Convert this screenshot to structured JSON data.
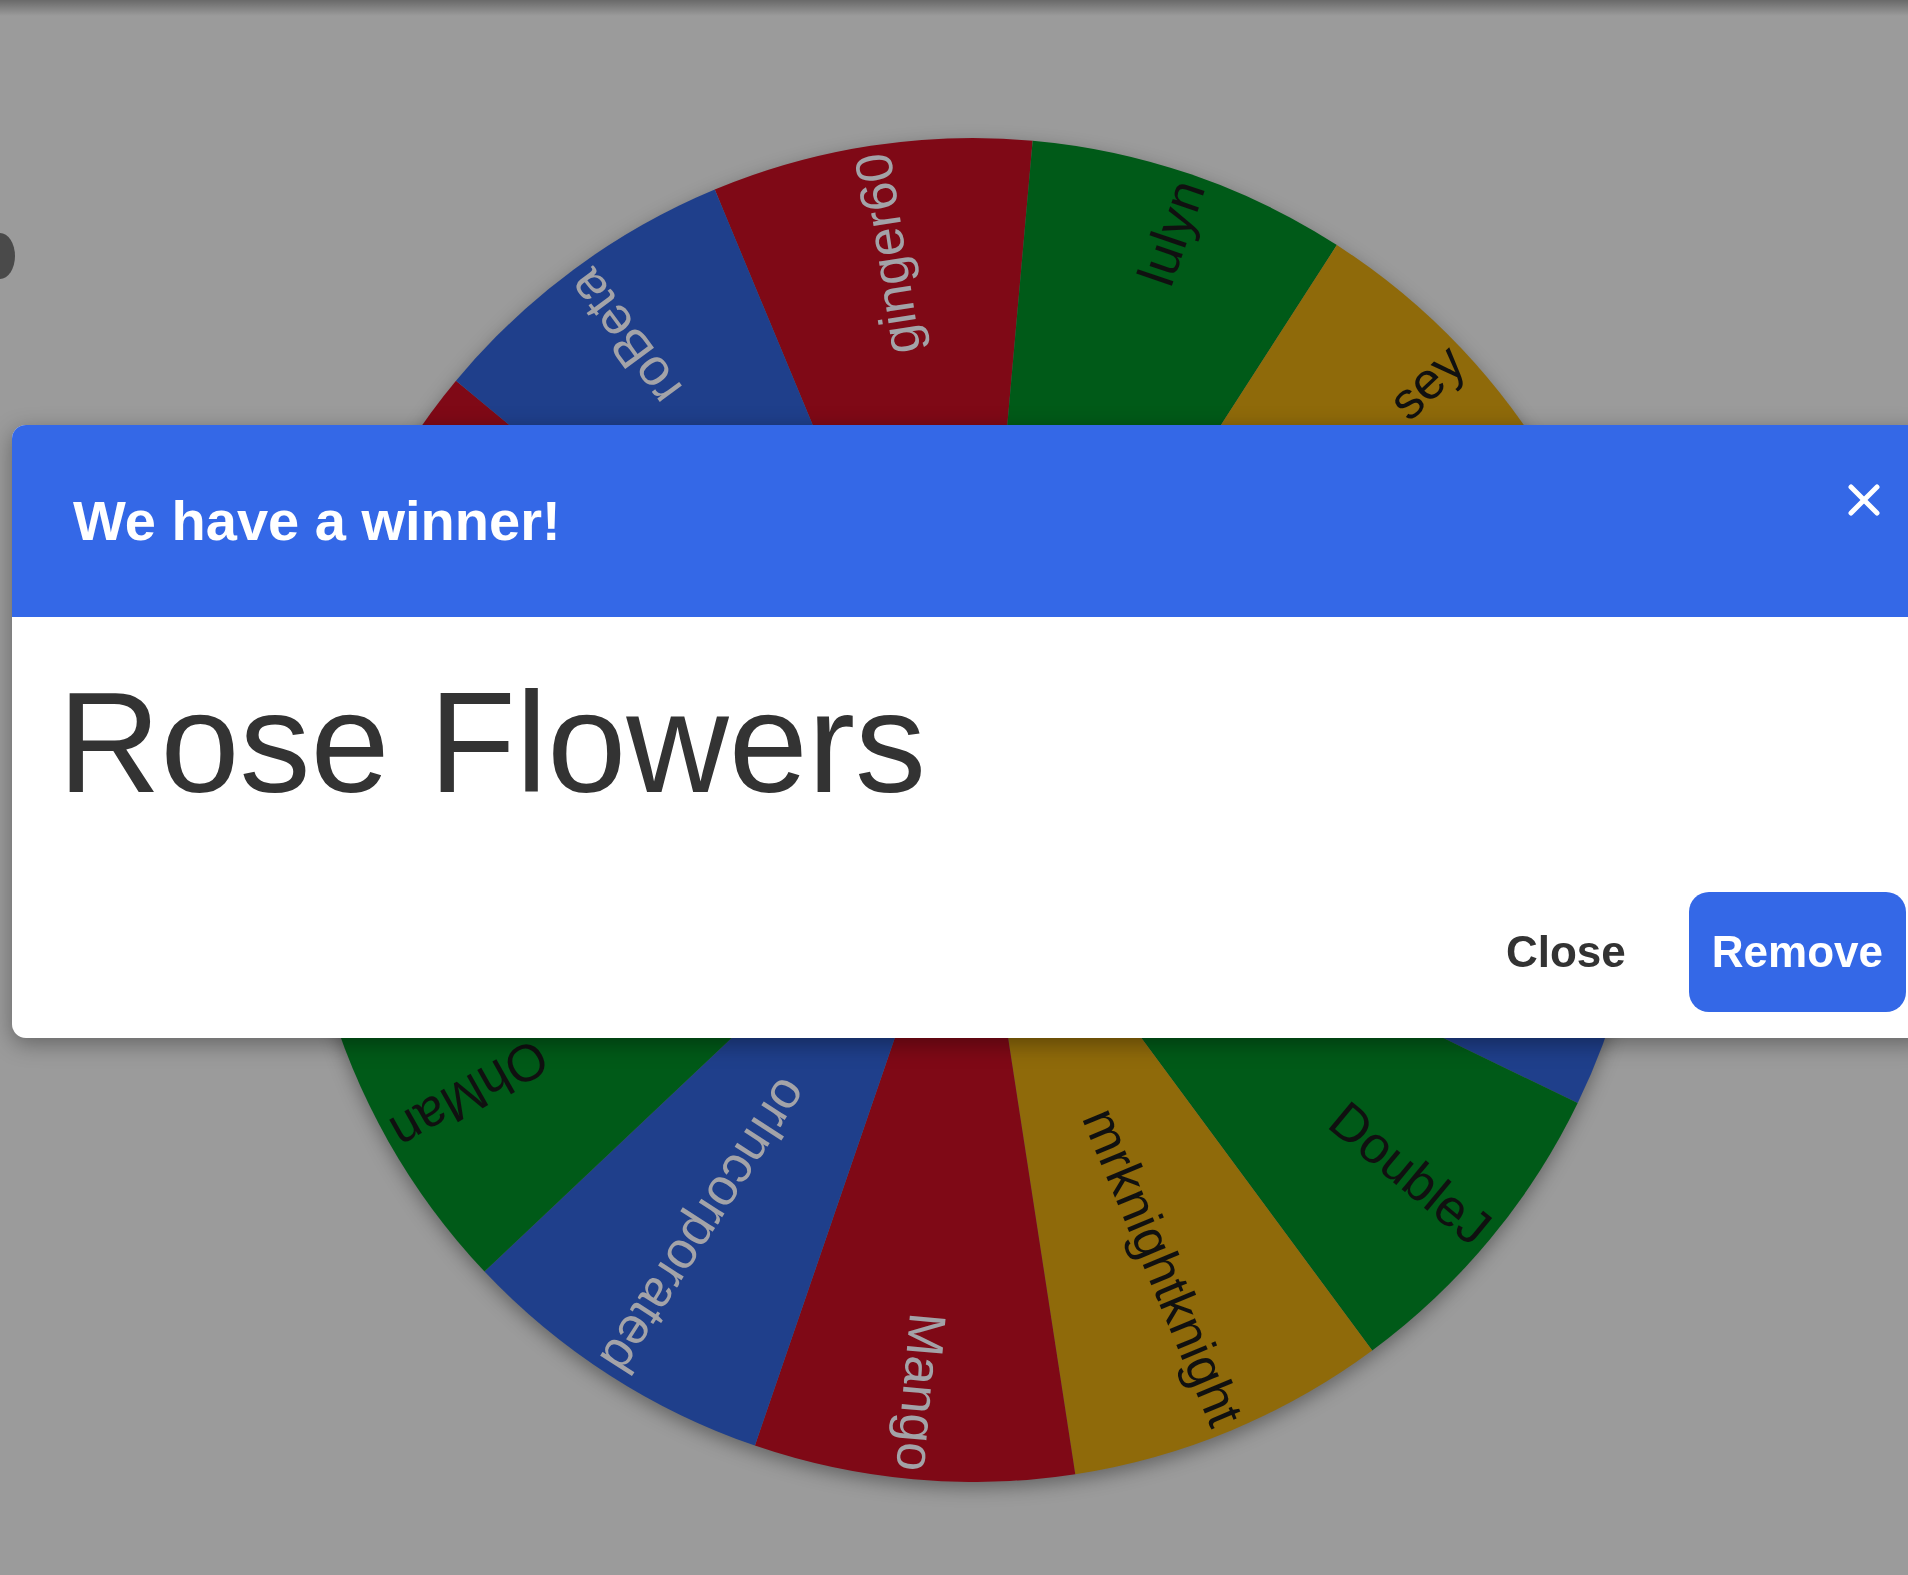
{
  "wheel": {
    "segments": [
      {
        "color": "#7f0916",
        "label": "ginger60"
      },
      {
        "color": "#005a18",
        "label": "lulyn"
      },
      {
        "color": "#8f6a0a",
        "label": "sey"
      },
      {
        "color": "#1f3f8b"
      },
      {
        "color": "#005a18",
        "label": "DoubleJ"
      },
      {
        "color": "#8f6a0a",
        "label": "mrknightknight"
      },
      {
        "color": "#7f0916",
        "label": "Mango"
      },
      {
        "color": "#1f3f8b",
        "label": "orIncorporated"
      },
      {
        "color": "#005a18",
        "label": "OhMan"
      },
      {
        "color": "#7f0916"
      },
      {
        "color": "#1f3f8b",
        "label": "roBeta"
      }
    ]
  },
  "dialog": {
    "title": "We have a winner!",
    "winner": "Rose Flowers",
    "buttons": [
      {
        "label": "Close",
        "kind": "secondary"
      },
      {
        "label": "Remove",
        "kind": "primary"
      }
    ]
  }
}
